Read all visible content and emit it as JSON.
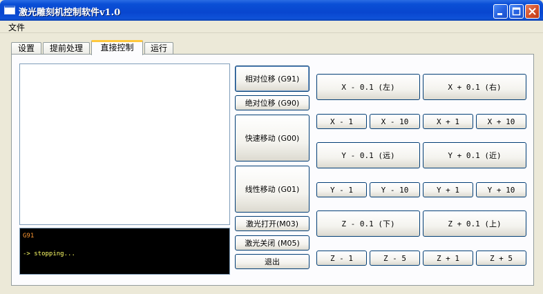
{
  "window": {
    "title": "激光雕刻机控制软件v1.0",
    "controls": {
      "minimize": "minimize-icon",
      "maximize": "maximize-icon",
      "close": "close-icon"
    }
  },
  "menu": {
    "items": [
      "文件"
    ]
  },
  "tabs": [
    {
      "label": "设置",
      "active": false
    },
    {
      "label": "提前处理",
      "active": false
    },
    {
      "label": "直接控制",
      "active": true
    },
    {
      "label": "运行",
      "active": false
    }
  ],
  "console": {
    "lines": [
      "G91",
      "-> stopping..."
    ]
  },
  "mode_buttons": {
    "relative": "相对位移 (G91)",
    "absolute": "绝对位移 (G90)",
    "rapid": "快速移动 (G00)",
    "linear": "线性移动 (G01)",
    "laser_on": "激光打开(M03)",
    "laser_off": "激光关闭 (M05)",
    "exit": "退出"
  },
  "jog": {
    "x_minus_01": "X - 0.1 (左)",
    "x_plus_01": "X + 0.1 (右)",
    "x_minus_1": "X - 1",
    "x_minus_10": "X - 10",
    "x_plus_1": "X + 1",
    "x_plus_10": "X + 10",
    "y_minus_01": "Y - 0.1 (远)",
    "y_plus_01": "Y + 0.1 (近)",
    "y_minus_1": "Y - 1",
    "y_minus_10": "Y - 10",
    "y_plus_1": "Y + 1",
    "y_plus_10": "Y + 10",
    "z_minus_01": "Z - 0.1 (下)",
    "z_plus_01": "Z + 0.1 (上)",
    "z_minus_1": "Z - 1",
    "z_minus_5": "Z - 5",
    "z_plus_1": "Z + 1",
    "z_plus_5": "Z + 5"
  },
  "colors": {
    "titlebar": "#0a4fd6",
    "window_bg": "#ece9d8",
    "console_bg": "#000000",
    "console_cmd": "#ff9933",
    "console_msg": "#ffff66",
    "active_tab_accent": "#ffc83c"
  }
}
